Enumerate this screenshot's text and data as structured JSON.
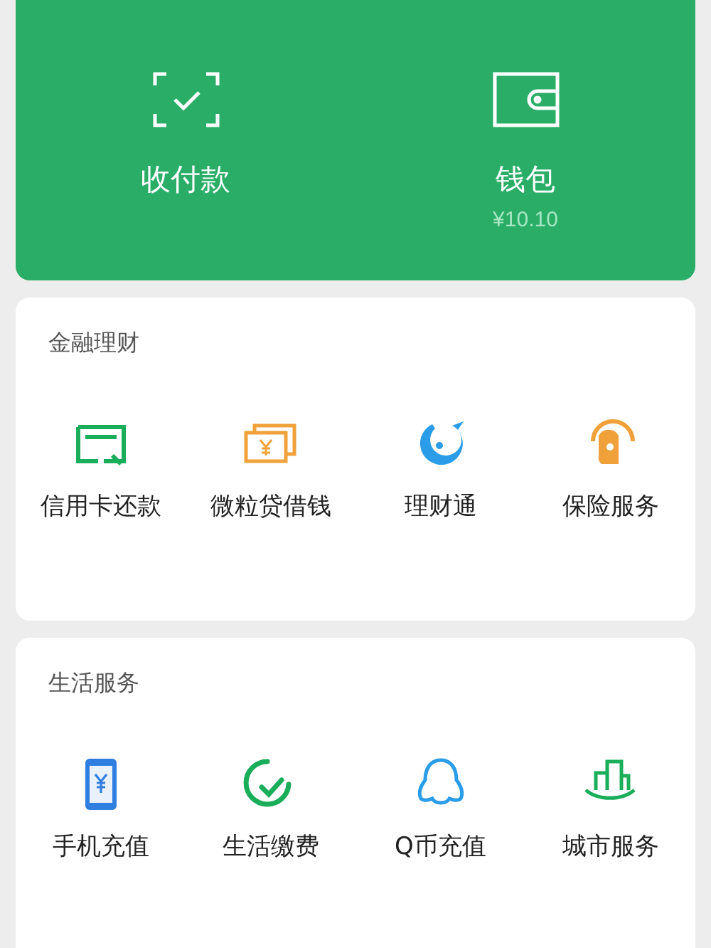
{
  "header": {
    "items": [
      {
        "label": "收付款"
      },
      {
        "label": "钱包",
        "amount": "¥10.10"
      }
    ]
  },
  "sections": [
    {
      "title": "金融理财",
      "items": [
        {
          "label": "信用卡还款"
        },
        {
          "label": "微粒贷借钱"
        },
        {
          "label": "理财通"
        },
        {
          "label": "保险服务"
        }
      ]
    },
    {
      "title": "生活服务",
      "items": [
        {
          "label": "手机充值"
        },
        {
          "label": "生活缴费"
        },
        {
          "label": "Q币充值"
        },
        {
          "label": "城市服务"
        }
      ]
    }
  ]
}
